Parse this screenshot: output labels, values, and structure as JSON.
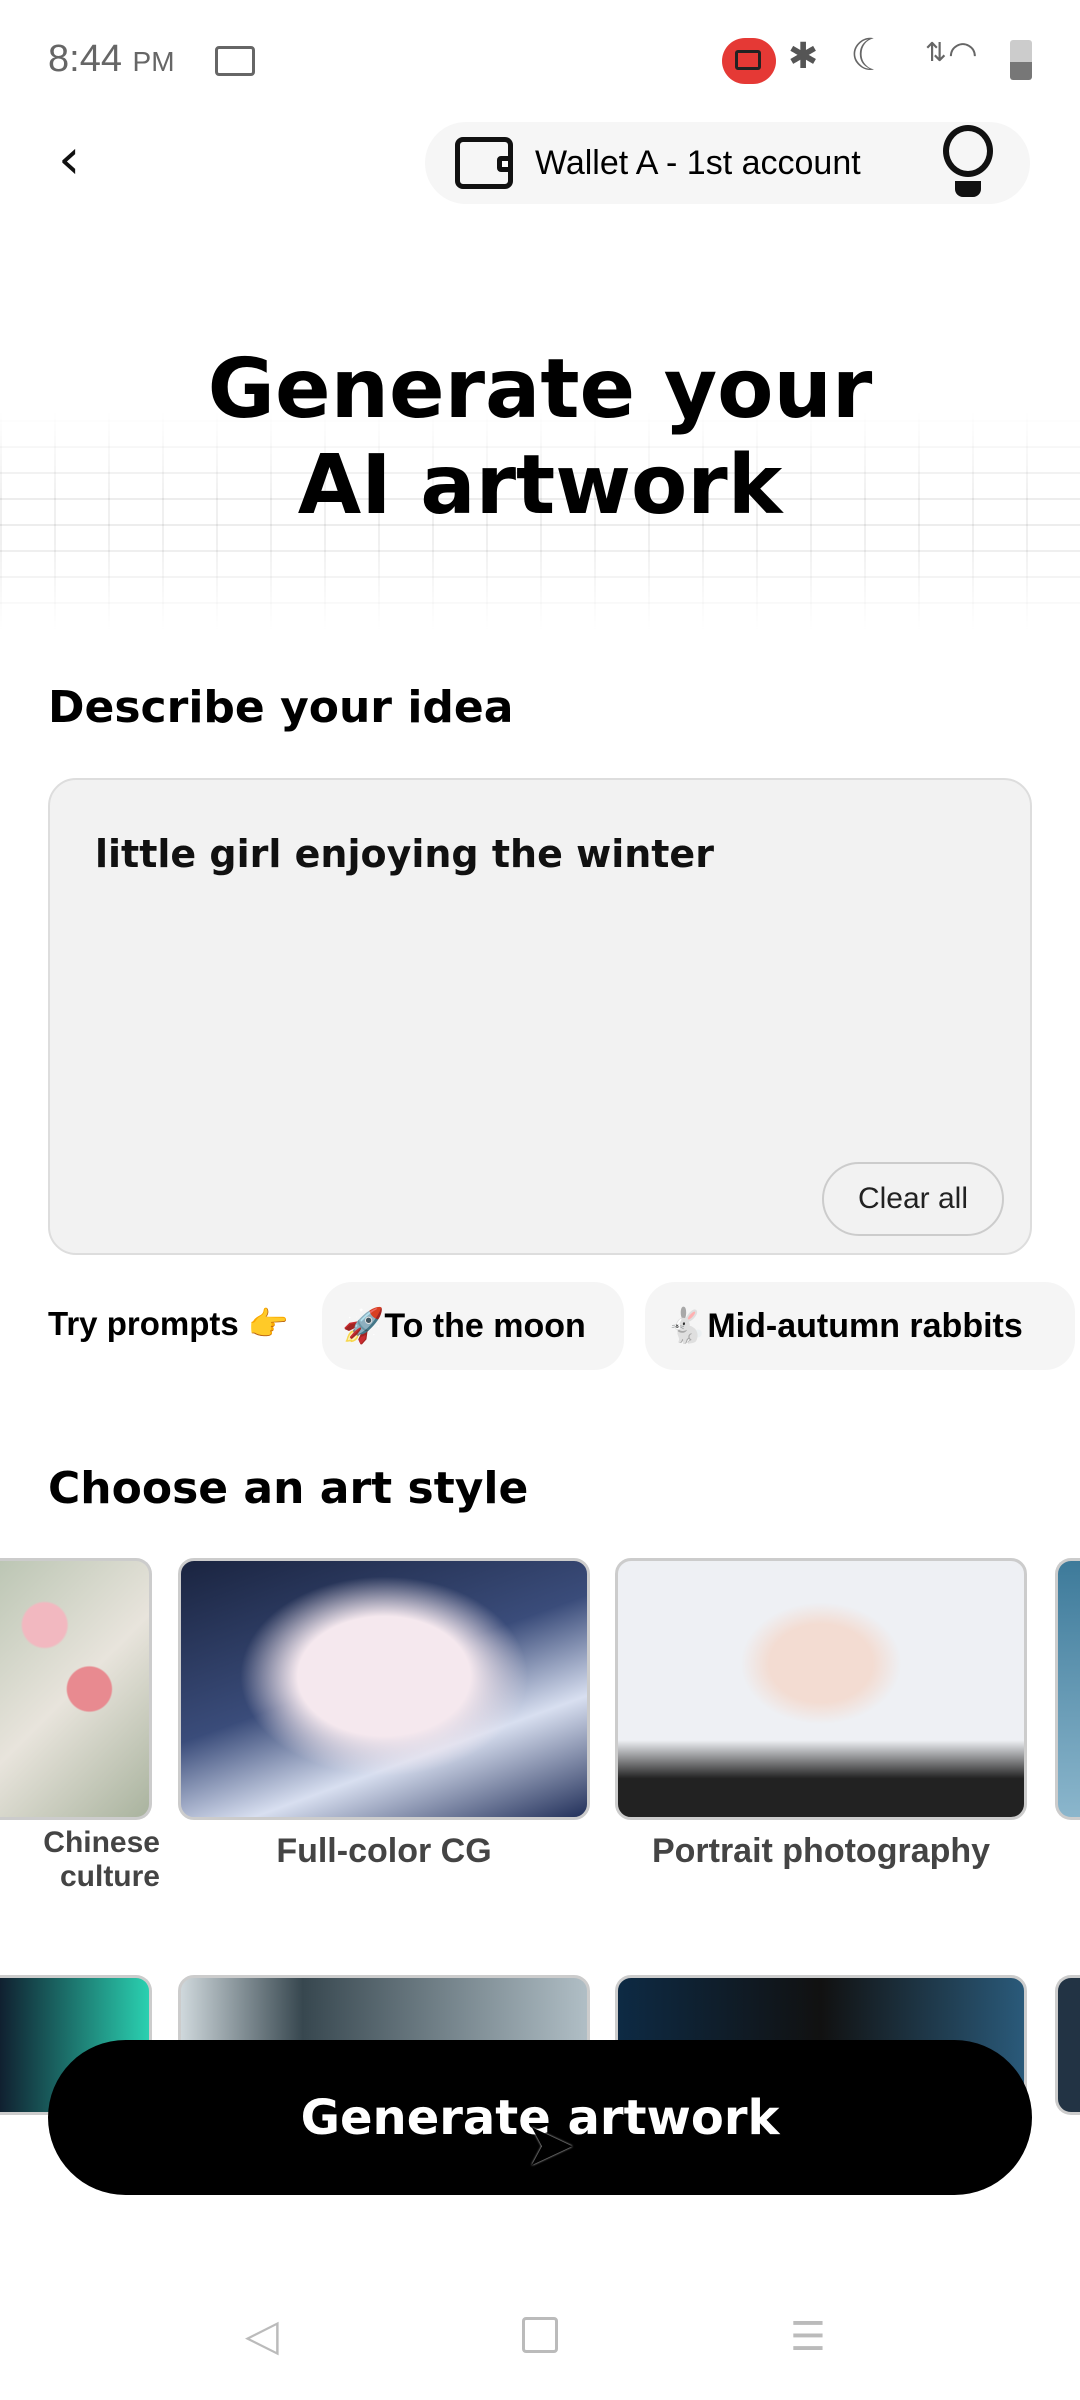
{
  "status": {
    "time": "8:44",
    "ampm": "PM",
    "icons": [
      "screen-record-icon",
      "recording-icon",
      "bluetooth-icon",
      "dnd-moon-icon",
      "data-icon",
      "wifi-icon",
      "battery-icon"
    ],
    "record_color": "#e53935"
  },
  "header": {
    "wallet_label": "Wallet A - 1st account"
  },
  "hero": {
    "line1": "Generate your",
    "line2": "AI artwork"
  },
  "describe": {
    "heading": "Describe your idea",
    "value": "little girl enjoying the winter",
    "clear_label": "Clear all"
  },
  "prompts": {
    "label": "Try prompts 👉",
    "chips": [
      {
        "label": "🚀To the moon"
      },
      {
        "label": "🐇Mid-autumn rabbits"
      }
    ]
  },
  "styles": {
    "heading": "Choose an art style",
    "items": [
      {
        "label": "Chinese culture"
      },
      {
        "label": "Full-color CG"
      },
      {
        "label": "Portrait photography"
      }
    ]
  },
  "generate_label": "Generate artwork"
}
